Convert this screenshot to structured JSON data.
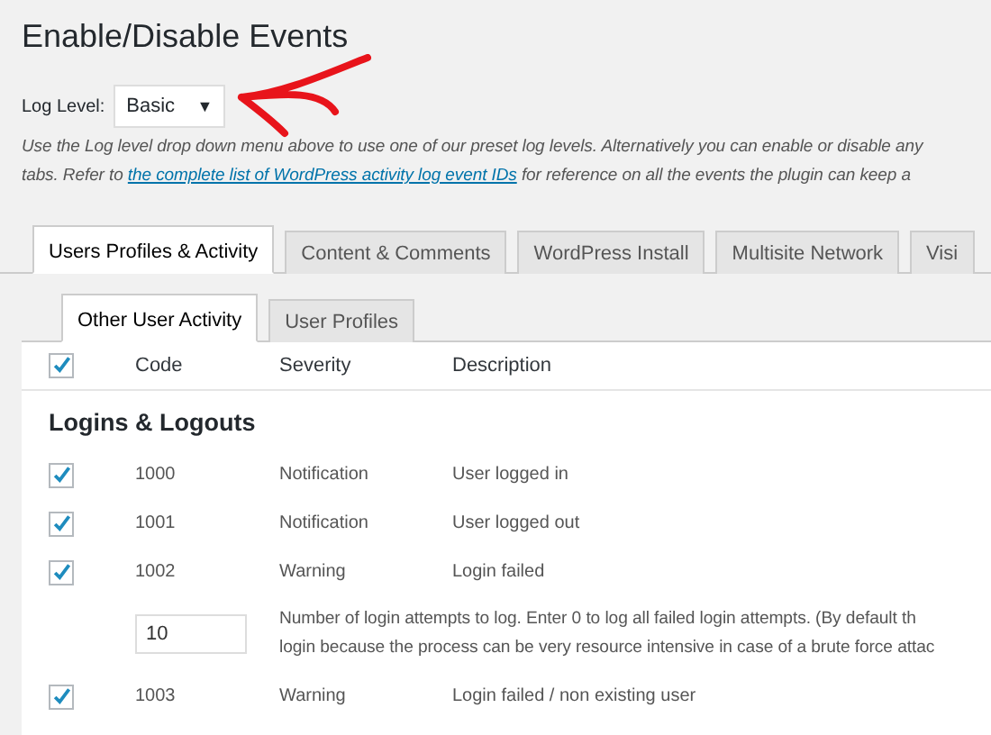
{
  "title": "Enable/Disable Events",
  "log_level": {
    "label": "Log Level:",
    "value": "Basic",
    "caret": "▼"
  },
  "intro": {
    "line_1": "Use the Log level drop down menu above to use one of our preset log levels. Alternatively you can enable or disable any",
    "line_2_before": "tabs. Refer to ",
    "link": "the complete list of WordPress activity log event IDs",
    "line_2_after": " for reference on all the events the plugin can keep a"
  },
  "tabs": [
    {
      "label": "Users Profiles & Activity",
      "selected": true
    },
    {
      "label": "Content & Comments",
      "selected": false
    },
    {
      "label": "WordPress Install",
      "selected": false
    },
    {
      "label": "Multisite Network",
      "selected": false
    },
    {
      "label": "Visi",
      "selected": false
    }
  ],
  "subtabs": [
    {
      "label": "Other User Activity",
      "selected": true
    },
    {
      "label": "User Profiles",
      "selected": false
    }
  ],
  "table": {
    "select_all_checked": true,
    "columns": [
      "Code",
      "Severity",
      "Description"
    ],
    "section": "Logins & Logouts",
    "rows": [
      {
        "kind": "event",
        "checked": true,
        "code": "1000",
        "severity": "Notification",
        "description": "User logged in"
      },
      {
        "kind": "event",
        "checked": true,
        "code": "1001",
        "severity": "Notification",
        "description": "User logged out"
      },
      {
        "kind": "event",
        "checked": true,
        "code": "1002",
        "severity": "Warning",
        "description": "Login failed"
      },
      {
        "kind": "setting",
        "value": "10",
        "line_1": "Number of login attempts to log. Enter 0 to log all failed login attempts. (By default th",
        "line_2": "login because the process can be very resource intensive in case of a brute force attac"
      },
      {
        "kind": "event",
        "checked": true,
        "code": "1003",
        "severity": "Warning",
        "description": "Login failed / non existing user"
      }
    ]
  }
}
